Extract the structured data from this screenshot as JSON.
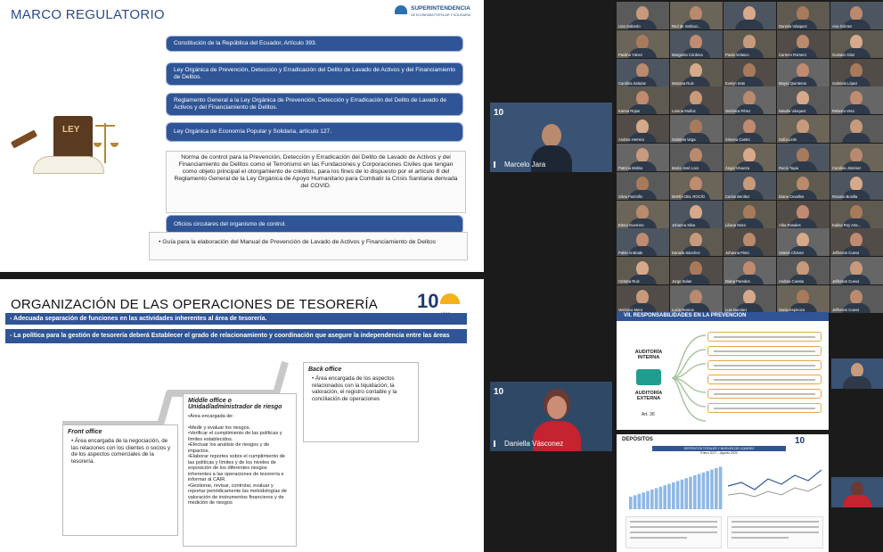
{
  "slide1": {
    "title": "MARCO REGULATORIO",
    "logo_text": "SUPERINTENDENCIA",
    "logo_sub": "DE ECONOMÍA POPULAR Y SOLIDARIA",
    "book_label": "LEY",
    "items": [
      "Constitución de la República del Ecuador, Artículo 393.",
      "Ley Orgánica de Prevención, Detección y Erradicación del Delito de Lavado de Activos y del Financiamiento de Delitos.",
      "Reglamento General a la Ley Orgánica de Prevención, Detección y Erradicación del Delito de Lavado de Activos y del Financiamiento de Delitos.",
      "Ley Orgánica de Economía Popular y Solidaria, artículo 127."
    ],
    "note": "Norma de control para la Prevención, Detección y Erradicación del Delito de Lavado de Activos y del Financiamiento de Delitos como el Terrorismo en las Fundaciones y Corporaciones Civiles que tengan como objeto principal el otorgamiento de créditos, para los fines de lo dispuesto por el artículo 8 del Reglamento General de la Ley Orgánica de Apoyo Humanitario para Combatir la Crisis Sanitaria derivada del COVID.",
    "oficios": "Oficios circulares del organismo de control.",
    "guia": "• Guía para la elaboración del Manual de Prevención de Lavado de Activos y Financiamiento de Delitos"
  },
  "slide2": {
    "title": "ORGANIZACIÓN DE LAS OPERACIONES DE TESORERÍA",
    "logo_num": "10",
    "logo_sub": "AÑOS",
    "bar1": "- Adecuada separación de funciones en las actividades inherentes al área de tesorería.",
    "bar2": "- La política para la gestión de tesorería deberá Establecer el grado de relacionamiento y coordinación que asegure la independencia entre las áreas",
    "front_title": "Front office",
    "front_text": "• Área encargada de la negociación, de las relaciones con los clientes o socios y de los aspectos comerciales de la tesorería.",
    "middle_title": "Middle office o Unidad/administrador de riesgo",
    "middle_text": "•Área encargada de:\n\n•Medir y evaluar los riesgos.\n•Verificar el cumplimiento de las políticas y límites establecidos.\n•Efectuar los análisis de riesgos y de impactos.\n•Elaborar reportes sobre el cumplimiento de las políticas y límites y de los niveles de exposición de los diferentes riesgos inherentes a las operaciones de tesorería e informar al CAIR.\n•Gestionar, revisar, controlar, evaluar y reportar periódicamente las metodologías de valoración de instrumentos financieros y de medición de riesgos",
    "back_title": "Back office",
    "back_text": "• Área encargada de los aspectos relacionados con la liquidación, la valoración, el registro contable y la conciliación de operaciones"
  },
  "speakers": [
    {
      "name": "Marcelo Jara",
      "logo": "10"
    },
    {
      "name": "Daniella Vásconez",
      "logo": "10"
    }
  ],
  "grid_names": [
    "Lisa Gallardo",
    "Red de Instituci...",
    "",
    "Daniela Vásquez",
    "Estefanía Vallejo",
    "Paulina Yánez",
    "Margarita Córdova",
    "Paola Velasco",
    "Carmen Romero",
    "MARÍA ROMERO...",
    "Carolina Salazar",
    "Mariana Ruiz",
    "Evelyn Soto",
    "Mayra Quinteros",
    "Jessica Paredes",
    "Karina Rojas",
    "Lorena Muñoz",
    "Verónica Pérez",
    "Natalia Vásquez",
    "Ruth Martínez",
    "Andrea Herrera",
    "Gabriela Vega",
    "Ximena Castro",
    "Sofía León",
    "Nancy Flores",
    "Patricia Molina",
    "María José Loor",
    "Ángel Vinueza",
    "Rocío Tapia",
    "Alexandra Mena",
    "Silvia Pazmiño",
    "MARÍA DEL ROCÍO",
    "Carlos Benítez",
    "Diana Cevallos",
    "Fernanda Ortiz",
    "Elena Guerrero",
    "Johanna Silva",
    "Liliana Mora",
    "Alba Rosales",
    "Mariela Cruz",
    "Pablo Andrade",
    "Daniela Sánchez",
    "Johanna Pinto",
    "Valeria Chávez",
    "Milton Torres",
    "Cristina Ruiz",
    "Jorge Salas",
    "Diana Paredes",
    "Andrea Cuesta",
    "Mónica Arias",
    "Verónica Mera",
    "Lucía Ramos",
    "Luis Narváez",
    "Sonia Espinoza",
    "Diego Ortiz",
    "Ana Gómez",
    "Gustavo Díaz",
    "Gabriela López",
    "Roberto Vera",
    "",
    "Carolina Jiménez",
    "Rosario Bonilla",
    "Kalina Roy Arte...",
    "Jefferson Cueva"
  ],
  "slide3": {
    "title": "VII. RESPONSABILIDADES EN LA PREVENCIÓN",
    "label1": "AUDITORÍA INTERNA",
    "label2": "AUDITORÍA EXTERNA",
    "art": "Art. 36"
  },
  "slide4": {
    "title": "DEPÓSITOS",
    "chart_title": "DEPÓSITOS TOTALES Y NIVELES DE LIQUIDEZ",
    "chart_sub": "Enero 2017 – Agosto 2020"
  }
}
